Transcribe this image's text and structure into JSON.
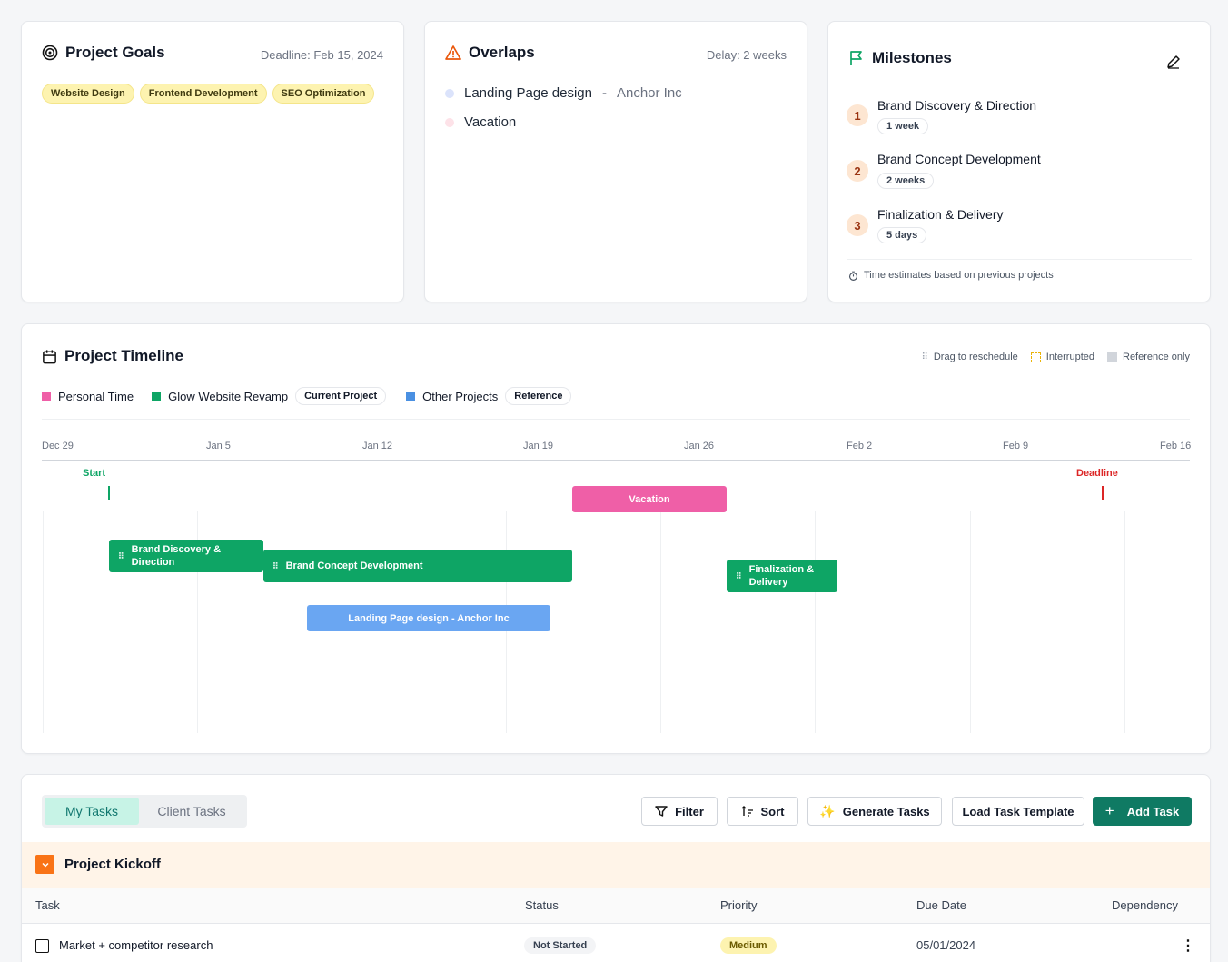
{
  "goals": {
    "title": "Project Goals",
    "deadline": "Deadline: Feb 15, 2024",
    "tags": [
      "Website Design",
      "Frontend Development",
      "SEO Optimization"
    ]
  },
  "overlaps": {
    "title": "Overlaps",
    "delay": "Delay: 2 weeks",
    "items": [
      {
        "name": "Landing Page design",
        "client": "Anchor Inc",
        "color": "#dbe3fb"
      },
      {
        "name": "Vacation",
        "client": "",
        "color": "#fde2e8"
      }
    ]
  },
  "milestones": {
    "title": "Milestones",
    "items": [
      {
        "num": "1",
        "title": "Brand Discovery & Direction",
        "duration": "1 week"
      },
      {
        "num": "2",
        "title": "Brand Concept Development",
        "duration": "2 weeks"
      },
      {
        "num": "3",
        "title": "Finalization & Delivery",
        "duration": "5 days"
      }
    ],
    "note": "Time estimates based on previous projects"
  },
  "timeline": {
    "title": "Project Timeline",
    "hints": {
      "drag": "Drag to reschedule",
      "interrupted": "Interrupted",
      "reference": "Reference only"
    },
    "legend": {
      "personal": "Personal Time",
      "glow": "Glow Website Revamp",
      "current_pill": "Current Project",
      "other": "Other Projects",
      "reference_pill": "Reference"
    },
    "ticks": [
      "Dec 29",
      "Jan 5",
      "Jan 12",
      "Jan 19",
      "Jan 26",
      "Feb 2",
      "Feb 9",
      "Feb 16"
    ],
    "markers": {
      "start": "Start",
      "deadline": "Deadline"
    },
    "bars": {
      "vacation": "Vacation",
      "discovery": "Brand Discovery & Direction",
      "concept": "Brand Concept Development",
      "finalization": "Finalization & Delivery",
      "landing": "Landing Page design - Anchor Inc"
    },
    "colors": {
      "personal": "#ef5fa7",
      "glow": "#0ea565",
      "other": "#6aa6f2"
    }
  },
  "tasks": {
    "tabs": [
      "My Tasks",
      "Client Tasks"
    ],
    "buttons": {
      "filter": "Filter",
      "sort": "Sort",
      "generate": "Generate Tasks",
      "template": "Load Task Template",
      "add": "Add Task"
    },
    "group": "Project Kickoff",
    "headers": [
      "Task",
      "Status",
      "Priority",
      "Due Date",
      "Dependency"
    ],
    "rows": [
      {
        "task": "Market + competitor research",
        "status": "Not Started",
        "priority": "Medium",
        "due": "05/01/2024"
      }
    ]
  }
}
